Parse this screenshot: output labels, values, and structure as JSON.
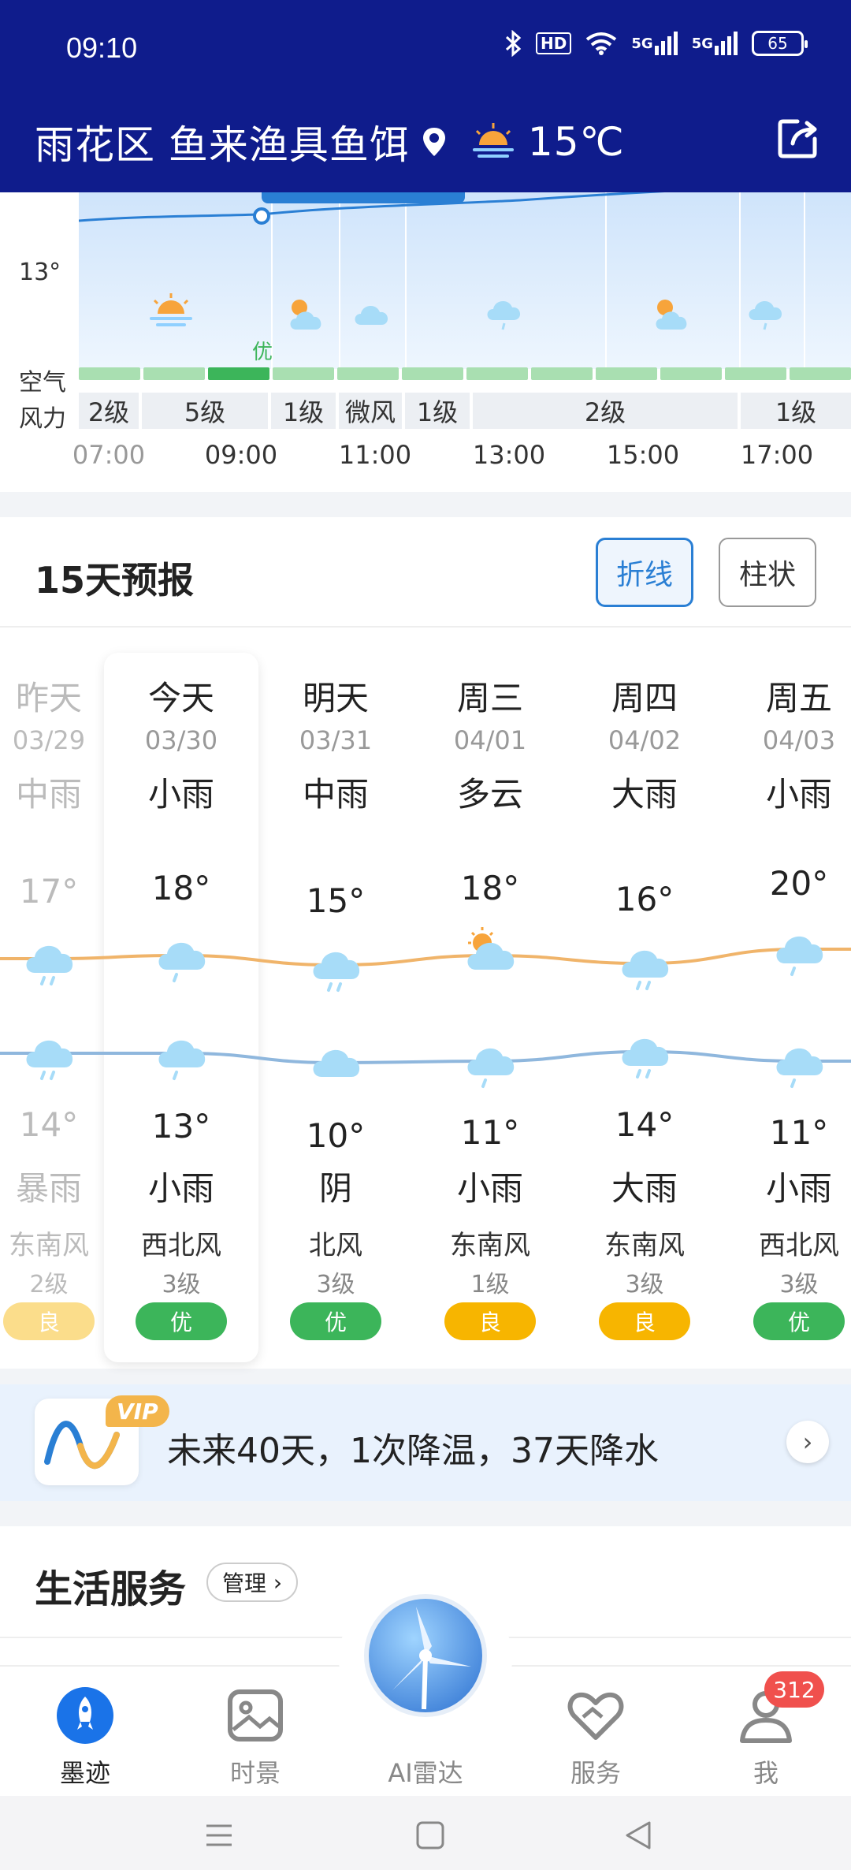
{
  "status": {
    "time": "09:10",
    "hd": "HD",
    "battery": "65",
    "net1": "5G",
    "net2": "5G"
  },
  "header": {
    "location": "雨花区 鱼来渔具鱼饵",
    "temperature": "15℃"
  },
  "hourly": {
    "y_label": "13°",
    "aq_label": "空气",
    "aq_value": "优",
    "wind_label": "风力",
    "winds": [
      "2级",
      "5级",
      "1级",
      "微风",
      "1级",
      "2级",
      "1级"
    ],
    "times": [
      "07:00",
      "09:00",
      "11:00",
      "13:00",
      "15:00",
      "17:00"
    ]
  },
  "forecast": {
    "title": "15天预报",
    "toggle_line": "折线",
    "toggle_bar": "柱状",
    "days": [
      {
        "name": "昨天",
        "date": "03/29",
        "day_weather": "中雨",
        "high": "17°",
        "low": "14°",
        "night_weather": "暴雨",
        "wind_dir": "东南风",
        "wind_level": "2级",
        "aqi": "良"
      },
      {
        "name": "今天",
        "date": "03/30",
        "day_weather": "小雨",
        "high": "18°",
        "low": "13°",
        "night_weather": "小雨",
        "wind_dir": "西北风",
        "wind_level": "3级",
        "aqi": "优"
      },
      {
        "name": "明天",
        "date": "03/31",
        "day_weather": "中雨",
        "high": "15°",
        "low": "10°",
        "night_weather": "阴",
        "wind_dir": "北风",
        "wind_level": "3级",
        "aqi": "优"
      },
      {
        "name": "周三",
        "date": "04/01",
        "day_weather": "多云",
        "high": "18°",
        "low": "11°",
        "night_weather": "小雨",
        "wind_dir": "东南风",
        "wind_level": "1级",
        "aqi": "良"
      },
      {
        "name": "周四",
        "date": "04/02",
        "day_weather": "大雨",
        "high": "16°",
        "low": "14°",
        "night_weather": "大雨",
        "wind_dir": "东南风",
        "wind_level": "3级",
        "aqi": "良"
      },
      {
        "name": "周五",
        "date": "04/03",
        "day_weather": "小雨",
        "high": "20°",
        "low": "11°",
        "night_weather": "小雨",
        "wind_dir": "西北风",
        "wind_level": "3级",
        "aqi": "优"
      }
    ],
    "colors": {
      "good": "#3cb55a",
      "moderate": "#f7b500",
      "high_line": "#f0b46a",
      "low_line": "#8fb7dd"
    }
  },
  "vip": {
    "badge": "VIP",
    "text": "未来40天，1次降温，37天降水"
  },
  "life": {
    "title": "生活服务",
    "manage": "管理"
  },
  "nav": {
    "items": [
      "墨迹",
      "时景",
      "AI雷达",
      "服务",
      "我"
    ],
    "badge": "312"
  }
}
